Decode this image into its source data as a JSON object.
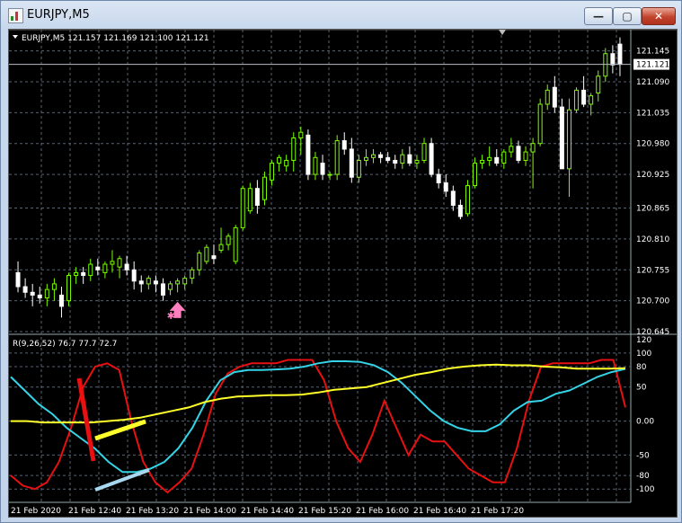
{
  "window": {
    "title": "EURJPY,M5",
    "minimize_glyph": "—",
    "maximize_glyph": "▢",
    "close_glyph": "✕"
  },
  "colors": {
    "background": "#000000",
    "grid": "#5a6472",
    "bull": "#7cfc00",
    "bear": "#ffffff",
    "rsi_red": "#e81010",
    "rsi_cyan": "#35d3e6",
    "rsi_yellow": "#ffff2a",
    "bid_line": "#b8bcc2",
    "arrow": "#ff7fbf"
  },
  "chart_data": [
    {
      "type": "candlestick",
      "info_label": "EURJPY,M5  121.157 121.169 121.100 121.121",
      "current_price": "121.121",
      "price_labels": [
        "121.145",
        "121.090",
        "121.035",
        "120.980",
        "120.925",
        "120.865",
        "120.810",
        "120.755",
        "120.700",
        "120.645"
      ],
      "price_values": [
        121.145,
        121.09,
        121.035,
        120.98,
        120.925,
        120.865,
        120.81,
        120.755,
        120.7,
        120.645
      ],
      "ylim": [
        120.645,
        121.17
      ],
      "candles": [
        [
          120.75,
          120.77,
          120.715,
          120.725
        ],
        [
          120.725,
          120.74,
          120.705,
          120.715
        ],
        [
          120.715,
          120.73,
          120.69,
          120.71
        ],
        [
          120.71,
          120.725,
          120.695,
          120.705
        ],
        [
          120.705,
          120.73,
          120.69,
          120.72
        ],
        [
          120.72,
          120.74,
          120.7,
          120.73
        ],
        [
          120.71,
          120.725,
          120.67,
          120.69
        ],
        [
          120.7,
          120.75,
          120.69,
          120.745
        ],
        [
          120.745,
          120.76,
          120.73,
          120.75
        ],
        [
          120.75,
          120.76,
          120.73,
          120.745
        ],
        [
          120.745,
          120.775,
          120.735,
          120.765
        ],
        [
          120.76,
          120.775,
          120.745,
          120.755
        ],
        [
          120.75,
          120.77,
          120.74,
          120.765
        ],
        [
          120.765,
          120.79,
          120.75,
          120.77
        ],
        [
          120.76,
          120.78,
          120.74,
          120.775
        ],
        [
          120.765,
          120.78,
          120.745,
          120.755
        ],
        [
          120.755,
          120.77,
          120.72,
          120.735
        ],
        [
          120.735,
          120.745,
          120.715,
          120.73
        ],
        [
          120.73,
          120.745,
          120.72,
          120.74
        ],
        [
          120.735,
          120.745,
          120.715,
          120.73
        ],
        [
          120.73,
          120.74,
          120.7,
          120.71
        ],
        [
          120.72,
          120.735,
          120.71,
          120.73
        ],
        [
          120.73,
          120.74,
          120.715,
          120.735
        ],
        [
          120.73,
          120.745,
          120.72,
          120.74
        ],
        [
          120.74,
          120.76,
          120.73,
          120.755
        ],
        [
          120.755,
          120.79,
          120.745,
          120.785
        ],
        [
          120.77,
          120.8,
          120.765,
          120.795
        ],
        [
          120.78,
          120.8,
          120.765,
          120.775
        ],
        [
          120.79,
          120.83,
          120.785,
          120.8
        ],
        [
          120.8,
          120.82,
          120.79,
          120.815
        ],
        [
          120.77,
          120.835,
          120.765,
          120.83
        ],
        [
          120.83,
          120.905,
          120.825,
          120.9
        ],
        [
          120.86,
          120.91,
          120.855,
          120.9
        ],
        [
          120.9,
          120.915,
          120.855,
          120.87
        ],
        [
          120.88,
          120.93,
          120.87,
          120.92
        ],
        [
          120.915,
          120.95,
          120.905,
          120.945
        ],
        [
          120.945,
          120.96,
          120.93,
          120.955
        ],
        [
          120.94,
          120.96,
          120.93,
          120.95
        ],
        [
          120.95,
          121.0,
          120.93,
          120.99
        ],
        [
          120.99,
          121.01,
          120.96,
          121.0
        ],
        [
          120.995,
          121.005,
          120.915,
          120.925
        ],
        [
          120.925,
          120.965,
          120.915,
          120.955
        ],
        [
          120.945,
          120.96,
          120.915,
          120.925
        ],
        [
          120.925,
          120.93,
          120.915,
          120.925
        ],
        [
          120.925,
          120.995,
          120.915,
          120.985
        ],
        [
          120.985,
          121.0,
          120.96,
          120.97
        ],
        [
          120.97,
          120.99,
          120.91,
          120.92
        ],
        [
          120.92,
          120.96,
          120.91,
          120.95
        ],
        [
          120.95,
          120.97,
          120.94,
          120.955
        ],
        [
          120.955,
          120.97,
          120.945,
          120.96
        ],
        [
          120.96,
          120.965,
          120.945,
          120.955
        ],
        [
          120.955,
          120.965,
          120.945,
          120.95
        ],
        [
          120.95,
          120.96,
          120.935,
          120.945
        ],
        [
          120.945,
          120.97,
          120.935,
          120.96
        ],
        [
          120.96,
          120.975,
          120.94,
          120.945
        ],
        [
          120.945,
          120.96,
          120.935,
          120.95
        ],
        [
          120.95,
          120.99,
          120.945,
          120.98
        ],
        [
          120.98,
          120.99,
          120.92,
          120.925
        ],
        [
          120.925,
          120.935,
          120.9,
          120.91
        ],
        [
          120.91,
          120.925,
          120.885,
          120.895
        ],
        [
          120.895,
          120.905,
          120.86,
          120.87
        ],
        [
          120.87,
          120.88,
          120.845,
          120.85
        ],
        [
          120.855,
          120.915,
          120.85,
          120.905
        ],
        [
          120.905,
          120.955,
          120.9,
          120.945
        ],
        [
          120.945,
          120.96,
          120.935,
          120.95
        ],
        [
          120.95,
          120.975,
          120.94,
          120.955
        ],
        [
          120.955,
          120.97,
          120.94,
          120.945
        ],
        [
          120.945,
          120.97,
          120.935,
          120.965
        ],
        [
          120.965,
          120.99,
          120.955,
          120.975
        ],
        [
          120.975,
          120.985,
          120.945,
          120.95
        ],
        [
          120.95,
          120.975,
          120.94,
          120.965
        ],
        [
          120.965,
          120.99,
          120.9,
          120.98
        ],
        [
          120.98,
          121.06,
          120.975,
          121.05
        ],
        [
          121.05,
          121.085,
          121.04,
          121.075
        ],
        [
          121.08,
          121.1,
          121.035,
          121.045
        ],
        [
          121.045,
          121.06,
          120.94,
          120.935
        ],
        [
          120.935,
          121.06,
          120.885,
          121.04
        ],
        [
          121.04,
          121.08,
          121.035,
          121.075
        ],
        [
          121.075,
          121.1,
          121.045,
          121.05
        ],
        [
          121.05,
          121.07,
          121.03,
          121.065
        ],
        [
          121.07,
          121.11,
          121.055,
          121.1
        ],
        [
          121.1,
          121.15,
          121.09,
          121.14
        ],
        [
          121.14,
          121.155,
          121.105,
          121.12
        ],
        [
          121.157,
          121.169,
          121.1,
          121.121
        ]
      ],
      "signal_arrow": {
        "candle_index": 22,
        "price": 120.698
      }
    },
    {
      "type": "line",
      "label": "R(9,26,52) 76.7 77.7 72.7",
      "y_labels": [
        "120",
        "100",
        "80",
        "50",
        "0.00",
        "-50",
        "-80",
        "-100"
      ],
      "y_values": [
        120,
        100,
        80,
        50,
        0,
        -50,
        -80,
        -100
      ],
      "ylim": [
        -105,
        125
      ],
      "series": [
        {
          "values": [
            -80,
            -95,
            -100,
            -90,
            -60,
            -10,
            50,
            80,
            85,
            75,
            0,
            -60,
            -90,
            -105,
            -90,
            -70,
            -20,
            40,
            70,
            80,
            85,
            85,
            85,
            90,
            90,
            90,
            60,
            0,
            -40,
            -60,
            -20,
            30,
            -10,
            -50,
            -20,
            -30,
            -30,
            -50,
            -70,
            -80,
            -90,
            -90,
            -40,
            30,
            80,
            85,
            85,
            85,
            85,
            90,
            90,
            20
          ]
        },
        {
          "values": [
            65,
            45,
            25,
            10,
            -10,
            -25,
            -40,
            -60,
            -75,
            -75,
            -70,
            -60,
            -40,
            -10,
            30,
            60,
            72,
            75,
            75,
            76,
            77,
            80,
            85,
            88,
            88,
            87,
            82,
            72,
            56,
            36,
            16,
            0,
            -10,
            -15,
            -15,
            -5,
            15,
            28,
            30,
            40,
            45,
            55,
            65,
            72,
            76.7
          ]
        },
        {
          "values": [
            0,
            0,
            -2,
            -2,
            -2,
            -2,
            0,
            2,
            5,
            10,
            15,
            20,
            28,
            33,
            36,
            37,
            38,
            38,
            39,
            42,
            46,
            48,
            50,
            56,
            62,
            68,
            72,
            77,
            80,
            82,
            83,
            82,
            82,
            80,
            79,
            77,
            77,
            77,
            77.7
          ]
        }
      ]
    }
  ],
  "time_labels": [
    "21 Feb 2020",
    "21 Feb 12:40",
    "21 Feb 13:20",
    "21 Feb 14:00",
    "21 Feb 14:40",
    "21 Feb 15:20",
    "21 Feb 16:00",
    "21 Feb 16:40",
    "21 Feb 17:20"
  ]
}
